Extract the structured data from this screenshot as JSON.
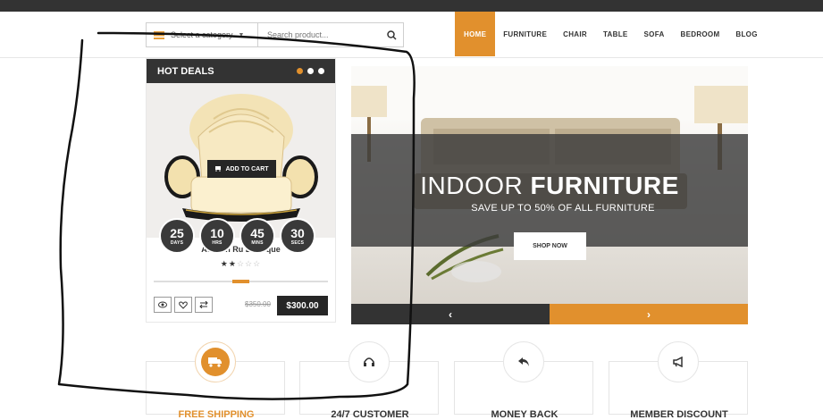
{
  "colors": {
    "accent": "#e1902d",
    "dark": "#333333"
  },
  "search": {
    "category_label": "Select a category",
    "placeholder": "Search product...",
    "icon": "search-icon"
  },
  "nav": {
    "items": [
      "HOME",
      "FURNITURE",
      "CHAIR",
      "TABLE",
      "SOFA",
      "BEDROOM",
      "BLOG"
    ],
    "active": "HOME"
  },
  "hot_deals": {
    "title": "HOT DEALS",
    "add_to_cart": "ADD TO CART",
    "timer": [
      {
        "value": "25",
        "unit": "DAYS"
      },
      {
        "value": "10",
        "unit": "HRS"
      },
      {
        "value": "45",
        "unit": "MINS"
      },
      {
        "value": "30",
        "unit": "SECS"
      }
    ],
    "product_name": "Aenean Ru Bristique",
    "rating": {
      "value": 2,
      "max": 5
    },
    "old_price": "$350.00",
    "price": "$300.00",
    "action_icons": [
      "eye-icon",
      "heart-icon",
      "compare-icon"
    ]
  },
  "slider": {
    "title_light": "INDOOR",
    "title_bold": "FURNITURE",
    "subtitle": "SAVE UP TO 50% OF ALL FURNITURE",
    "button": "SHOP NOW",
    "prev": "‹",
    "next": "›"
  },
  "features": [
    {
      "title": "FREE SHIPPING",
      "icon": "truck-icon",
      "highlight": true
    },
    {
      "title": "24/7 CUSTOMER",
      "icon": "headphones-icon",
      "highlight": false
    },
    {
      "title": "MONEY BACK",
      "icon": "money-back-icon",
      "highlight": false
    },
    {
      "title": "MEMBER DISCOUNT",
      "icon": "megaphone-icon",
      "highlight": false
    }
  ]
}
